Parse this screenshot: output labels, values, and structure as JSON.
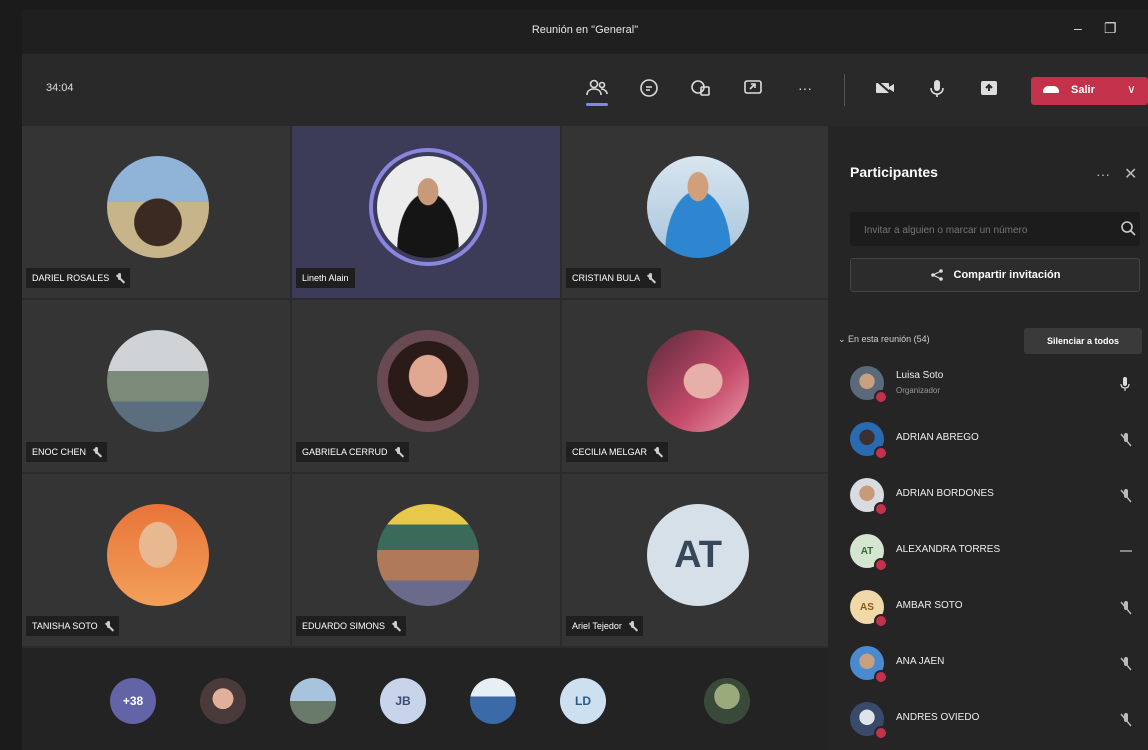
{
  "window": {
    "title": "Reunión en \"General\"",
    "minimize": "–",
    "maximize": "❐"
  },
  "toolbar": {
    "timer": "34:04",
    "more": "···",
    "leave_label": "Salir",
    "leave_chevron": "∨"
  },
  "tiles": [
    {
      "name": "DARIEL ROSALES",
      "muted": true
    },
    {
      "name": "Lineth Alain",
      "muted": false,
      "speaking": true
    },
    {
      "name": "CRISTIAN BULA",
      "muted": true
    },
    {
      "name": "ENOC CHEN",
      "muted": true
    },
    {
      "name": "GABRIELA CERRUD",
      "muted": true
    },
    {
      "name": "CECILIA MELGAR",
      "muted": true
    },
    {
      "name": "TANISHA SOTO",
      "muted": true
    },
    {
      "name": "EDUARDO SIMONS",
      "muted": true
    },
    {
      "name": "Ariel Tejedor",
      "muted": true,
      "initials": "AT"
    }
  ],
  "strip": [
    {
      "label": "+38"
    },
    {
      "label": ""
    },
    {
      "label": ""
    },
    {
      "label": "JB"
    },
    {
      "label": ""
    },
    {
      "label": "LD"
    },
    {
      "label": ""
    }
  ],
  "panel": {
    "title": "Participantes",
    "more": "···",
    "close": "✕",
    "invite_placeholder": "Invitar a alguien o marcar un número",
    "share_label": "Compartir invitación",
    "section_label": "⌄ En esta reunión (54)",
    "mute_all": "Silenciar a todos"
  },
  "participants": [
    {
      "name": "Luisa Soto",
      "role": "Organizador",
      "mic": "on"
    },
    {
      "name": "ADRIAN ABREGO",
      "mic": "muted"
    },
    {
      "name": "ADRIAN BORDONES",
      "mic": "muted"
    },
    {
      "name": "ALEXANDRA TORRES",
      "initials": "AT",
      "mic": "none"
    },
    {
      "name": "AMBAR SOTO",
      "initials": "AS",
      "mic": "muted"
    },
    {
      "name": "ANA JAEN",
      "mic": "muted"
    },
    {
      "name": "ANDRES OVIEDO",
      "mic": "muted"
    }
  ],
  "colors": {
    "accent": "#7f85f5",
    "leave": "#c4314b",
    "panel": "#252525"
  }
}
